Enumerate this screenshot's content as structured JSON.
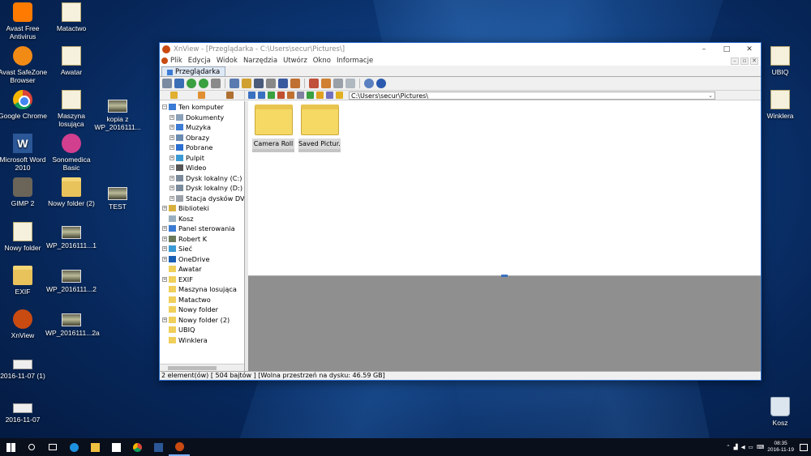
{
  "desktop": {
    "icons_left": [
      {
        "label": "Avast Free Antivirus",
        "icon": "avast-icon"
      },
      {
        "label": "Matactwo",
        "icon": "folder-file-icon"
      },
      {
        "label": "Avast SafeZone Browser",
        "icon": "safezone-icon"
      },
      {
        "label": "Awatar",
        "icon": "folder-file-icon"
      },
      {
        "label": "Google Chrome",
        "icon": "chrome-icon"
      },
      {
        "label": "Maszyna losująca",
        "icon": "folder-file-icon"
      },
      {
        "label": "kopia z WP_2016111...",
        "icon": "photo-icon"
      },
      {
        "label": "Microsoft Word 2010",
        "icon": "word-icon"
      },
      {
        "label": "Sonomedica Basic",
        "icon": "sonomedica-icon"
      },
      {
        "label": "GIMP 2",
        "icon": "gimp-icon"
      },
      {
        "label": "Nowy folder (2)",
        "icon": "folder-icon"
      },
      {
        "label": "TEST",
        "icon": "photo-icon"
      },
      {
        "label": "Nowy folder",
        "icon": "folder-file-icon"
      },
      {
        "label": "WP_2016111...1",
        "icon": "photo-icon"
      },
      {
        "label": "EXIF",
        "icon": "folder-icon"
      },
      {
        "label": "WP_2016111...2",
        "icon": "photo-icon"
      },
      {
        "label": "XnView",
        "icon": "xnview-icon"
      },
      {
        "label": "WP_2016111...2a",
        "icon": "photo-icon"
      },
      {
        "label": "2016-11-07 (1)",
        "icon": "image-icon"
      },
      {
        "label": "2016-11-07",
        "icon": "image-icon"
      }
    ],
    "icons_right": [
      {
        "label": "UBIQ",
        "icon": "folder-file-icon"
      },
      {
        "label": "Winklera",
        "icon": "folder-file-icon"
      },
      {
        "label": "Kosz",
        "icon": "recycle-bin-icon"
      }
    ]
  },
  "window": {
    "title": "XnView - [Przeglądarka - C:\\Users\\secur\\Pictures\\]",
    "controls": {
      "minimize": "–",
      "maximize": "□",
      "close": "✕"
    },
    "menu": [
      "Plik",
      "Edycja",
      "Widok",
      "Narzędzia",
      "Utwórz",
      "Okno",
      "Informacje"
    ],
    "mdi_controls": [
      "–",
      "▫",
      "✕"
    ],
    "tab_label": "Przeglądarka",
    "path": "C:\\Users\\secur\\Pictures\\",
    "tree": [
      {
        "label": "Ten komputer",
        "level": 0,
        "expander": "−",
        "icon": "computer-icon",
        "color": "#3b7bd4"
      },
      {
        "label": "Dokumenty",
        "level": 1,
        "expander": "+",
        "icon": "documents-icon",
        "color": "#8aa0b8"
      },
      {
        "label": "Muzyka",
        "level": 1,
        "expander": "+",
        "icon": "music-icon",
        "color": "#3b7bd4"
      },
      {
        "label": "Obrazy",
        "level": 1,
        "expander": "+",
        "icon": "pictures-icon",
        "color": "#6a8ab0"
      },
      {
        "label": "Pobrane",
        "level": 1,
        "expander": "+",
        "icon": "download-icon",
        "color": "#2a6ed0"
      },
      {
        "label": "Pulpit",
        "level": 1,
        "expander": "+",
        "icon": "desktop-icon",
        "color": "#3b9ad4"
      },
      {
        "label": "Wideo",
        "level": 1,
        "expander": "+",
        "icon": "video-icon",
        "color": "#555555"
      },
      {
        "label": "Dysk lokalny (C:)",
        "level": 1,
        "expander": "+",
        "icon": "drive-icon",
        "color": "#7a8a9a"
      },
      {
        "label": "Dysk lokalny (D:)",
        "level": 1,
        "expander": "+",
        "icon": "drive-icon",
        "color": "#7a8a9a"
      },
      {
        "label": "Stacja dysków DVD",
        "level": 1,
        "expander": "+",
        "icon": "dvd-icon",
        "color": "#9aa0a8"
      },
      {
        "label": "Biblioteki",
        "level": 0,
        "expander": "+",
        "icon": "libraries-icon",
        "color": "#d8b040"
      },
      {
        "label": "Kosz",
        "level": 0,
        "expander": "",
        "icon": "recycle-bin-icon",
        "color": "#9ab0c0"
      },
      {
        "label": "Panel sterowania",
        "level": 0,
        "expander": "+",
        "icon": "control-panel-icon",
        "color": "#3b7bd4"
      },
      {
        "label": "Robert K",
        "level": 0,
        "expander": "+",
        "icon": "user-icon",
        "color": "#6a7a5a"
      },
      {
        "label": "Sieć",
        "level": 0,
        "expander": "+",
        "icon": "network-icon",
        "color": "#3b9ad4"
      },
      {
        "label": "OneDrive",
        "level": 0,
        "expander": "+",
        "icon": "onedrive-icon",
        "color": "#1a5fb4"
      },
      {
        "label": "Awatar",
        "level": 0,
        "expander": "",
        "icon": "folder-icon",
        "color": "#f0cf5a"
      },
      {
        "label": "EXIF",
        "level": 0,
        "expander": "+",
        "icon": "folder-icon",
        "color": "#f0cf5a"
      },
      {
        "label": "Maszyna losująca",
        "level": 0,
        "expander": "",
        "icon": "folder-icon",
        "color": "#f0cf5a"
      },
      {
        "label": "Matactwo",
        "level": 0,
        "expander": "",
        "icon": "folder-icon",
        "color": "#f0cf5a"
      },
      {
        "label": "Nowy folder",
        "level": 0,
        "expander": "",
        "icon": "folder-icon",
        "color": "#f0cf5a"
      },
      {
        "label": "Nowy folder (2)",
        "level": 0,
        "expander": "+",
        "icon": "folder-icon",
        "color": "#f0cf5a"
      },
      {
        "label": "UBIQ",
        "level": 0,
        "expander": "",
        "icon": "folder-icon",
        "color": "#f0cf5a"
      },
      {
        "label": "Winklera",
        "level": 0,
        "expander": "",
        "icon": "folder-icon",
        "color": "#f0cf5a"
      }
    ],
    "thumbnails": [
      {
        "label": "Camera Roll"
      },
      {
        "label": "Saved Pictur..."
      }
    ],
    "status": "2 element(ów) [ 504 bajtów ] [Wolna przestrzeń na dysku: 46.59 GB]"
  },
  "taskbar": {
    "time": "08:35",
    "date": "2016-11-19",
    "tray_icons": [
      "chevron-up-icon",
      "network-tray-icon",
      "volume-icon",
      "battery-icon",
      "language-icon"
    ]
  },
  "colors": {
    "accent": "#2a6ed0",
    "folder": "#f6d865",
    "preview_bg": "#8f8f8f"
  }
}
